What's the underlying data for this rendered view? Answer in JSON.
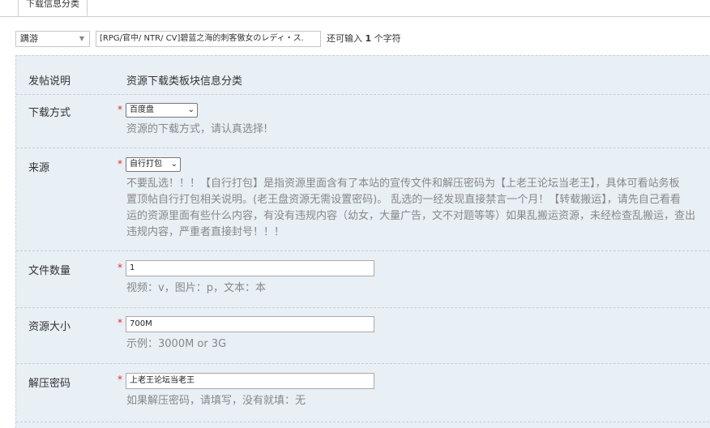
{
  "tab": {
    "label": "下载信息分类"
  },
  "title_row": {
    "category_value": "蹒游",
    "title_value": "[RPG/官中/ NTR/ CV]碧蓝之海的刺客傲女のレディ・ス.",
    "tip_prefix": "还可输入 ",
    "tip_count": "1",
    "tip_suffix": " 个字符"
  },
  "fields": {
    "notice": {
      "label": "发帖说明",
      "value": "资源下载类板块信息分类"
    },
    "download_method": {
      "label": "下载方式",
      "required": "*",
      "selected": "百度盘",
      "hint": "资源的下载方式，请认真选择!"
    },
    "source": {
      "label": "来源",
      "required": "*",
      "selected": "自行打包",
      "hint_lines": [
        "不要乱选！！！【自行打包】是指资源里面含有了本站的宣传文件和解压密码为【上老王论坛当老王】，具体可看站务板",
        "置顶帖自行打包相关说明。(老王盘资源无需设置密码)。 乱选的一经发现直接禁言一个月！【转载搬运】，请先自己看看",
        "运的资源里面有些什么内容，有没有违规内容（幼女，大量广告，文不对题等等）如果乱搬运资源，未经检查乱搬运，查出",
        "违规内容，严重者直接封号！！！"
      ]
    },
    "file_count": {
      "label": "文件数量",
      "required": "*",
      "value": "1",
      "hint": "视频：v，图片：p，文本：本"
    },
    "resource_size": {
      "label": "资源大小",
      "required": "*",
      "value": "700M",
      "hint": "示例：3000M or 3G"
    },
    "password": {
      "label": "解压密码",
      "required": "*",
      "value": "上老王论坛当老王",
      "hint": "如果解压密码，请填写，没有就填：无"
    }
  },
  "colors": {
    "panel_bg": "#e8eff5",
    "required_star": "#e0302c",
    "hint_text": "#888888"
  }
}
